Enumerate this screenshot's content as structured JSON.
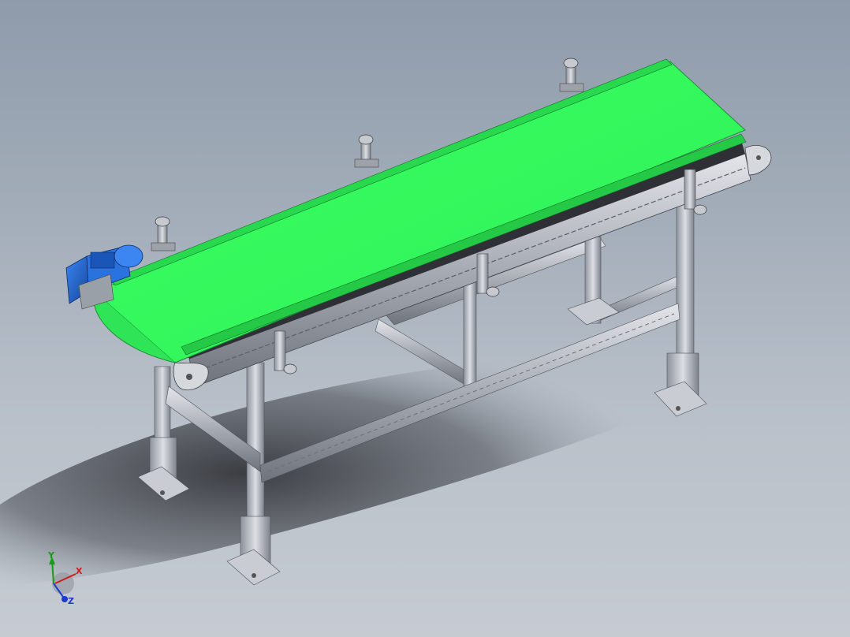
{
  "colors": {
    "background_top": "#8f9bab",
    "background_bottom": "#c6cbd2",
    "belt": "#33ff5c",
    "motor": "#1f63d6",
    "frame": "#b9bcc3"
  },
  "triad": {
    "x_label": "X",
    "y_label": "Y",
    "z_label": "Z"
  }
}
